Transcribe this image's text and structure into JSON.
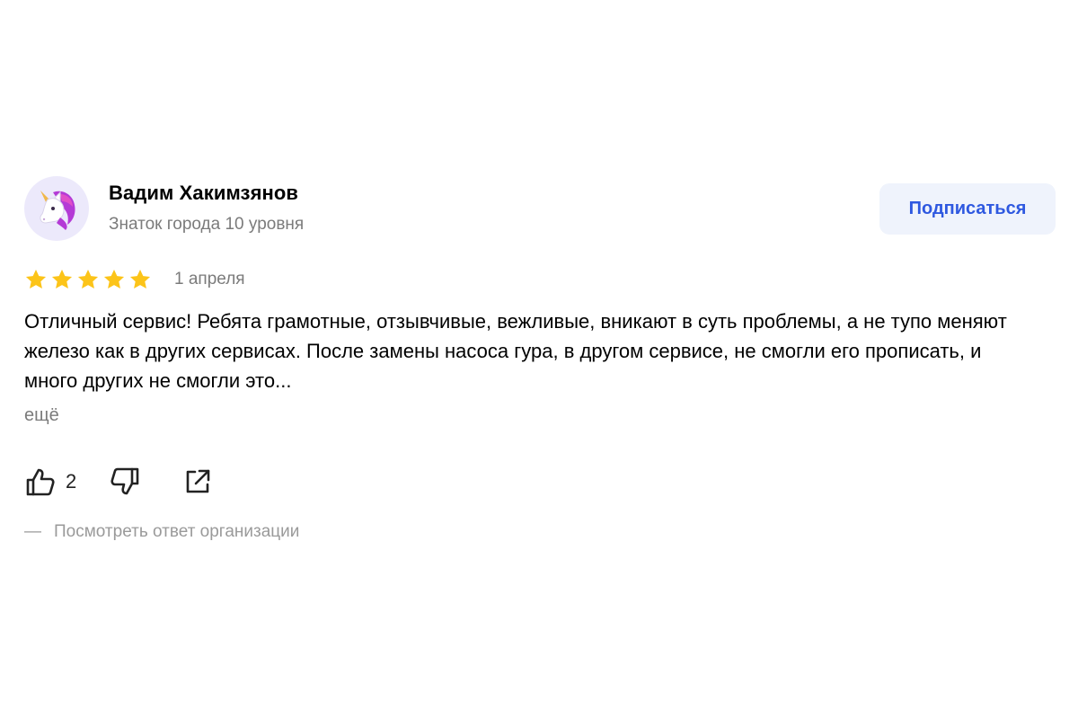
{
  "review": {
    "author": {
      "name": "Вадим Хакимзянов",
      "level": "Знаток города 10 уровня",
      "avatar_icon": "unicorn-icon"
    },
    "subscribe_label": "Подписаться",
    "rating": 5,
    "max_rating": 5,
    "date": "1 апреля",
    "text": "Отличный сервис! Ребята грамотные, отзывчивые, вежливые, вникают в суть проблемы, а не тупо меняют железо как в других сервисах. После замены насоса гура, в другом сервисе, не смогли его прописать, и много других не смогли это...",
    "more_label": "ещё",
    "likes_count": "2",
    "org_answer_dash": "—",
    "org_answer_label": "Посмотреть ответ организации"
  },
  "colors": {
    "star": "#fcc419",
    "accent": "#2e58e0",
    "button_bg": "#eff3fc",
    "muted_text": "#7b7b7b",
    "avatar_bg": "#ece9fb"
  }
}
